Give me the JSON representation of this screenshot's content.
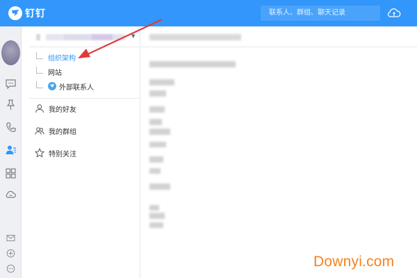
{
  "app": {
    "title": "钉钉"
  },
  "search": {
    "placeholder": "联系人、群组、聊天记录"
  },
  "tree": {
    "items": [
      {
        "label": "组织架构",
        "active": true
      },
      {
        "label": "网站",
        "active": false
      },
      {
        "label": "外部联系人",
        "active": false
      }
    ]
  },
  "nav": {
    "items": [
      {
        "label": "我的好友",
        "icon": "person-icon"
      },
      {
        "label": "我的群组",
        "icon": "group-icon"
      },
      {
        "label": "特别关注",
        "icon": "star-icon"
      }
    ]
  },
  "rail": {
    "icons": [
      "chat-icon",
      "pin-icon",
      "phone-icon",
      "contacts-icon",
      "apps-icon",
      "cloud-icon",
      "mail-icon",
      "add-icon",
      "more-icon"
    ],
    "active": "contacts-icon"
  },
  "colors": {
    "brand": "#3296fa",
    "annotation": "#e0393a",
    "watermark": "#f58220"
  },
  "watermark": {
    "text": "Downyi.com"
  }
}
